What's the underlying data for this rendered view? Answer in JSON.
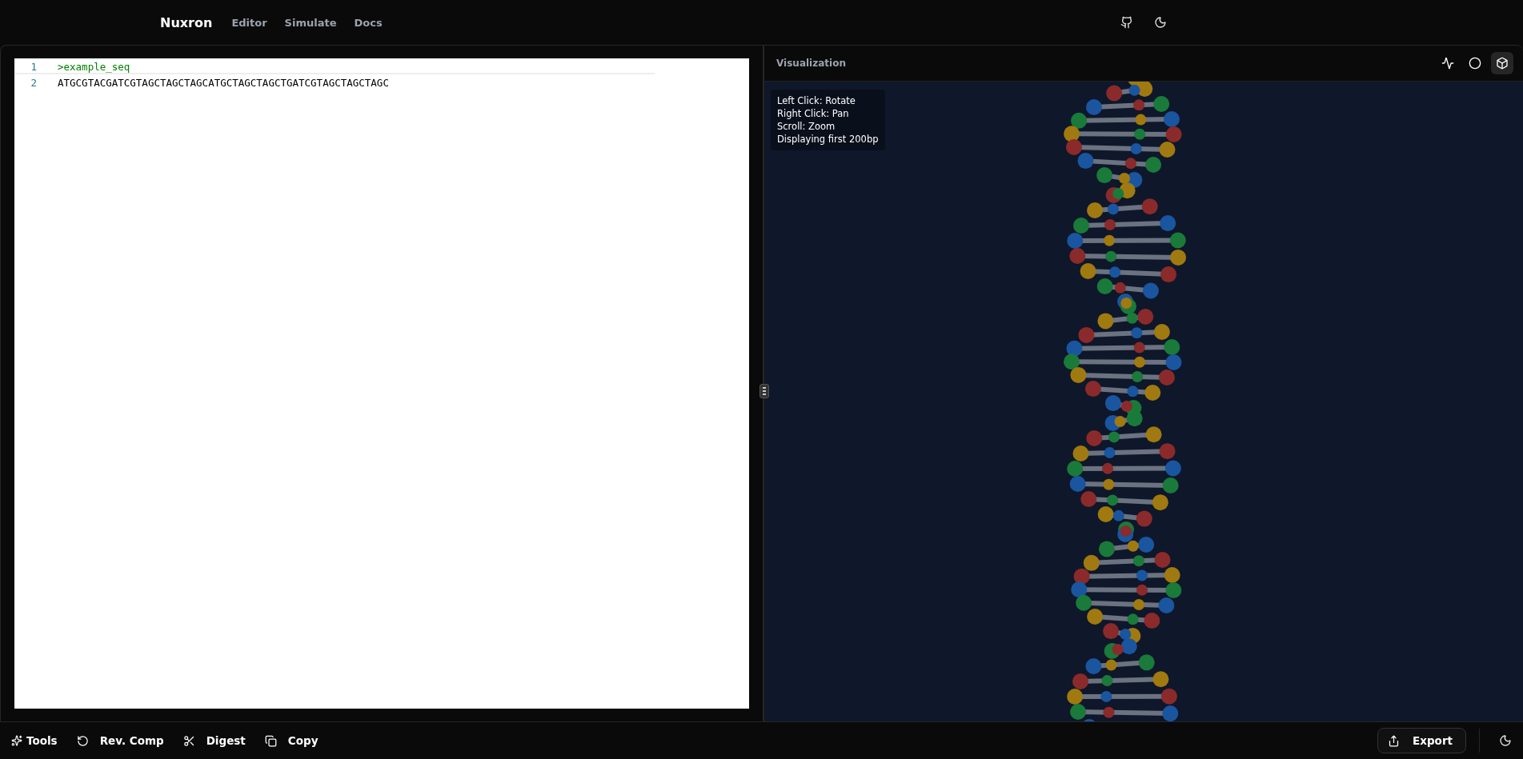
{
  "header": {
    "brand": "Nuxron",
    "nav": [
      {
        "label": "Editor",
        "selected": false
      },
      {
        "label": "Simulate",
        "selected": false
      },
      {
        "label": "Docs",
        "selected": false
      }
    ],
    "actions": [
      {
        "kind": "github"
      },
      {
        "kind": "theme"
      }
    ]
  },
  "editor": {
    "lines": [
      {
        "number": "1",
        "text": ">example_seq",
        "kind": "header"
      },
      {
        "number": "2",
        "text": "ATGCGTACGATCGTAGCTAGCTAGCATGCTAGCTAGCTGATCGTAGCTAGCTAGC",
        "kind": "sequence"
      }
    ]
  },
  "visualization": {
    "title": "Visualization",
    "modes": [
      {
        "kind": "signal",
        "selected": false
      },
      {
        "kind": "circle",
        "selected": false
      },
      {
        "kind": "cube",
        "selected": true
      }
    ],
    "help": [
      "Left Click: Rotate",
      "Right Click: Pan",
      "Scroll: Zoom",
      "Displaying first 200bp"
    ]
  },
  "toolbar": {
    "tools": [
      {
        "kind": "tools",
        "label": "Tools"
      },
      {
        "kind": "revcomp",
        "label": "Rev. Comp"
      },
      {
        "kind": "digest",
        "label": "Digest"
      },
      {
        "kind": "copy",
        "label": "Copy"
      }
    ],
    "export": "Export"
  }
}
